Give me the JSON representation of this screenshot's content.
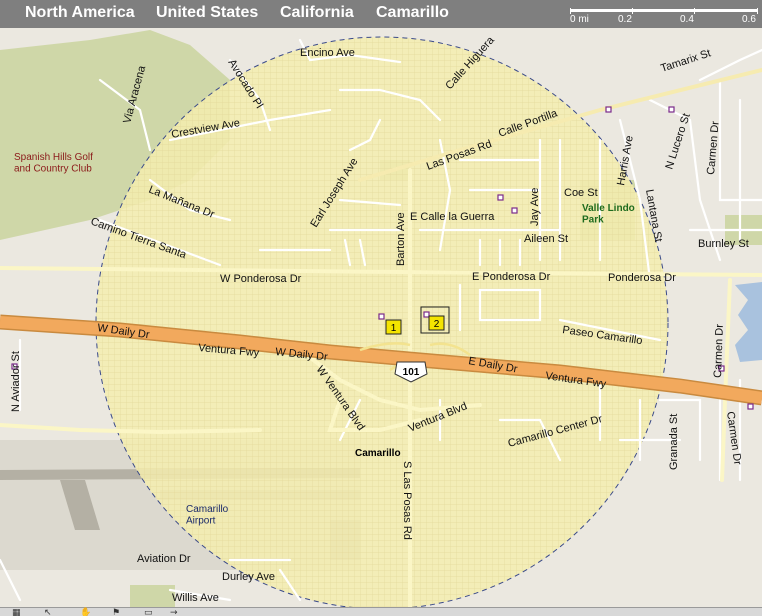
{
  "breadcrumb": [
    "North America",
    "United States",
    "California",
    "Camarillo"
  ],
  "scale": {
    "labels": [
      "0 mi",
      "0.2",
      "0.4",
      "0.6"
    ]
  },
  "colors": {
    "land": "#ebe8e0",
    "park": "#cfd7a8",
    "radius_fill": "#f4edaf",
    "highway": "#f2a95d",
    "street": "#ffffff",
    "arterial": "#fbf6c6",
    "water": "#a9c2de",
    "marker": "#f4e400"
  },
  "places": {
    "golf_club": "Spanish Hills Golf\nand Country Club",
    "park": "Valle Lindo\nPark",
    "city": "Camarillo",
    "airport": "Camarillo\nAirport"
  },
  "highway_shield": "101",
  "markers": [
    "1",
    "2"
  ],
  "streets": {
    "encino": "Encino Ave",
    "avocado": "Avocado Pl",
    "calle_higuera": "Calle Higuera",
    "tamarix": "Tamarix St",
    "via_aracena": "Via Aracena",
    "crestview": "Crestview Ave",
    "calle_portilla": "Calle Portilla",
    "n_lucero": "N Lucero St",
    "carmen_n": "Carmen Dr",
    "las_posas": "Las Posas Rd",
    "harris": "Harris Ave",
    "lantana": "Lantana St",
    "earl_joseph": "Earl Joseph Ave",
    "coe": "Coe St",
    "la_manana": "La Mañana Dr",
    "barton": "Barton Ave",
    "calle_la_guerra": "E Calle la Guerra",
    "jay": "Jay Ave",
    "aileen": "Aileen St",
    "bumley": "Burnley St",
    "camino_tierra": "Camino Tierra Santa",
    "w_ponderosa": "W Ponderosa Dr",
    "e_ponderosa": "E Ponderosa Dr",
    "ponderosa": "Ponderosa Dr",
    "w_daily_1": "W Daily Dr",
    "paseo": "Paseo Camarillo",
    "ventura_fwy_1": "Ventura Fwy",
    "w_daily_2": "W Daily Dr",
    "carmen_mid": "Carmen Dr",
    "n_aviador": "N Aviador St",
    "e_daily": "E Daily Dr",
    "ventura_fwy_2": "Ventura Fwy",
    "w_ventura_blvd": "W Ventura Blvd",
    "ventura_blvd": "Ventura Blvd",
    "granada": "Granada St",
    "carmen_s": "Carmen Dr",
    "camarillo_center": "Camarillo Center Dr",
    "s_las_posas": "S Las Posas Rd",
    "aviation": "Aviation Dr",
    "durley": "Durley Ave",
    "willis": "Willis Ave"
  },
  "toolbar": {
    "icons": [
      "grid-icon",
      "pointer-icon",
      "hand-icon",
      "flag-icon",
      "ruler-icon",
      "arrow-icon"
    ]
  }
}
